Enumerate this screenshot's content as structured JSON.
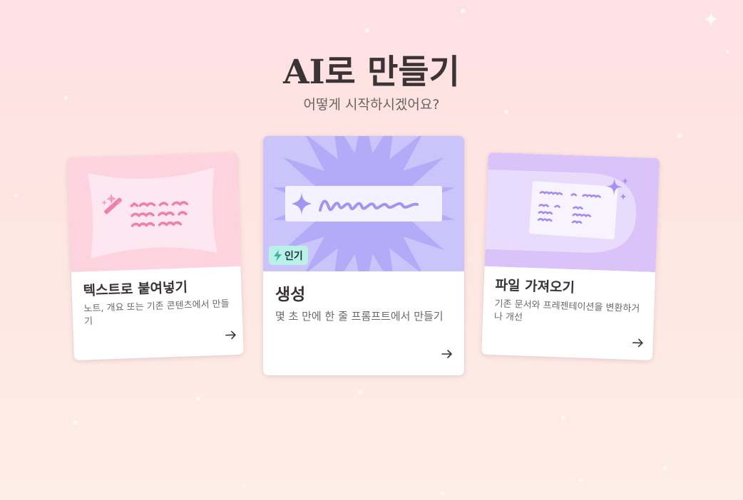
{
  "page": {
    "title": "AI로 만들기",
    "subtitle": "어떻게 시작하시겠어요?"
  },
  "cards": {
    "paste": {
      "title": "텍스트로 붙여넣기",
      "description": "노트, 개요 또는 기존 콘텐츠에서 만들기",
      "icon": "magic-wand-icon",
      "arrow_icon": "arrow-right-icon",
      "color": "#fdd6e0"
    },
    "generate": {
      "title": "생성",
      "description": "몇 초 만에 한 줄 프롬프트에서 만들기",
      "badge": "인기",
      "badge_icon": "lightning-icon",
      "icon": "sparkle-icon",
      "arrow_icon": "arrow-right-icon",
      "color": "#c9c3fb"
    },
    "import": {
      "title": "파일 가져오기",
      "description": "기존 문서와 프레젠테이션을 변환하거나 개선",
      "icon": "sparkles-icon",
      "arrow_icon": "arrow-right-icon",
      "color": "#dcc6f8"
    }
  },
  "colors": {
    "background_top": "#fee1e3",
    "background_bottom": "#fdeee6",
    "badge": "#b9f1e8",
    "accent_purple": "#a89af2",
    "accent_pink": "#ee7fae"
  }
}
